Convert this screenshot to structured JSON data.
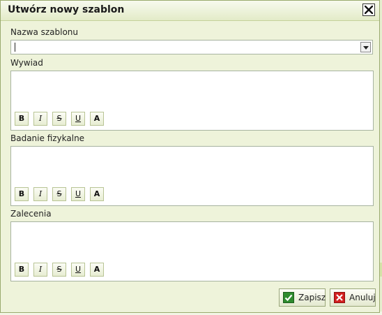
{
  "dialog": {
    "title": "Utwórz nowy szablon",
    "close_icon": "close-icon"
  },
  "template_name": {
    "label": "Nazwa szablonu",
    "value": ""
  },
  "sections": [
    {
      "label": "Wywiad"
    },
    {
      "label": "Badanie fizykalne"
    },
    {
      "label": "Zalecenia"
    }
  ],
  "toolbar": {
    "bold": "B",
    "italic": "I",
    "strike": "S",
    "underline": "U",
    "color": "A"
  },
  "buttons": {
    "save": "Zapisz",
    "cancel": "Anuluj"
  },
  "colors": {
    "dialog_bg": "#eef3da",
    "save_icon": "#2e8b2e",
    "cancel_icon": "#d21f1f"
  }
}
